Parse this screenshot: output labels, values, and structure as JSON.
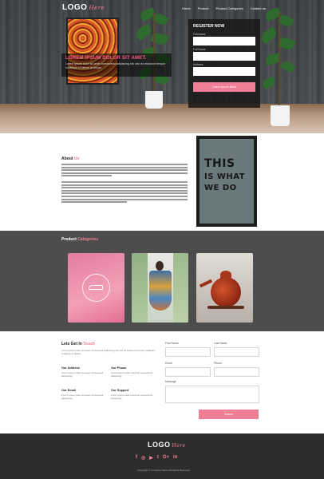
{
  "nav": {
    "logo": "LOGO",
    "logo_script": "Here",
    "links": [
      "Home",
      "Product",
      "Product Categories",
      "Contact us"
    ]
  },
  "hero": {
    "feature_title": "LOREM IPSUM DOLOR SIT AMET.",
    "feature_sub": "Lorem ipsum dolor sit amet consectetur adipiscing elit, sed do eiusmod tempor incididunt ut labore et dolore."
  },
  "register": {
    "title": "REGISTER NOW",
    "labels": [
      "Full Name",
      "Full Name",
      "Address"
    ],
    "button": "Lorem Ipsum Dolor"
  },
  "about": {
    "title_a": "About",
    "title_b": "Us",
    "poster_lines": [
      "THIS",
      "IS WHAT",
      "WE DO"
    ]
  },
  "categories": {
    "title_a": "Product",
    "title_b": "Categories"
  },
  "contact": {
    "title_a": "Lets Get In",
    "title_b": "Touch",
    "intro": "Lorem ipsum dolor sit amet consectetur adipiscing elit sed do eiusmod tempor incididunt ut labore et dolore.",
    "blocks": [
      {
        "heading": "Our Address",
        "text": "Lorem ipsum dolor sit amet consectetur adipiscing."
      },
      {
        "heading": "Our Phone",
        "text": "Lorem ipsum dolor sit amet consectetur adipiscing."
      },
      {
        "heading": "Our Email",
        "text": "Lorem ipsum dolor sit amet consectetur adipiscing."
      },
      {
        "heading": "Our Support",
        "text": "Lorem ipsum dolor sit amet consectetur adipiscing."
      }
    ],
    "form_labels": [
      "First Name",
      "Last Name",
      "Email",
      "Phone",
      "Message"
    ],
    "submit": "Submit"
  },
  "footer": {
    "logo": "LOGO",
    "logo_script": "Here",
    "socials": [
      "f",
      "◎",
      "▶",
      "t",
      "G+",
      "in"
    ],
    "copyright": "Copyright © Company Name All Rights Reserved"
  },
  "colors": {
    "accent": "#f07f96",
    "dark": "#2d2d2d",
    "section": "#4d4d4d"
  }
}
